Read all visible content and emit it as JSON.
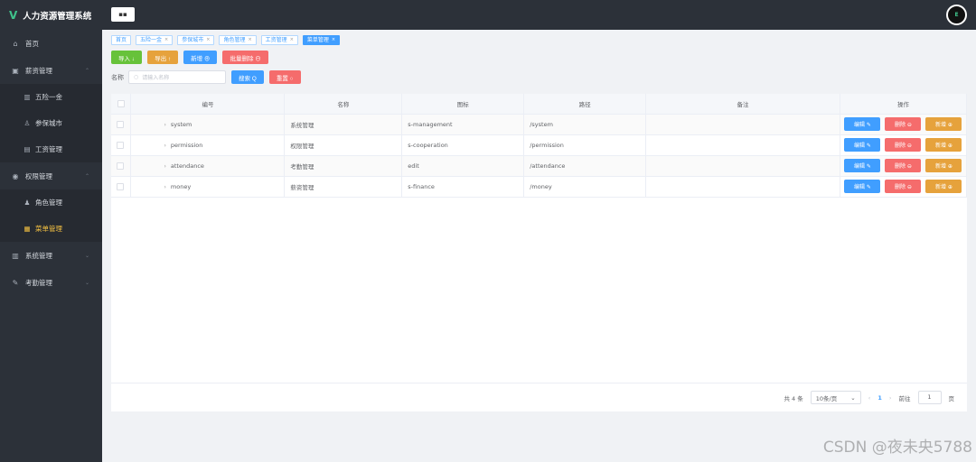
{
  "app": {
    "title": "人力资源管理系统",
    "logo_letter": "V",
    "avatar_text": "E"
  },
  "sidebar": {
    "items": [
      {
        "label": "首页",
        "icon": "home-icon",
        "glyph": "⌂"
      },
      {
        "label": "薪资管理",
        "icon": "salary-icon",
        "glyph": "▣",
        "chev": "⌃"
      },
      {
        "label": "五险一金",
        "icon": "chart-icon",
        "glyph": "▥",
        "sub": true
      },
      {
        "label": "参保城市",
        "icon": "user-icon",
        "glyph": "♙",
        "sub": true
      },
      {
        "label": "工资管理",
        "icon": "document-icon",
        "glyph": "▤",
        "sub": true
      },
      {
        "label": "权限管理",
        "icon": "lock-icon",
        "glyph": "◉",
        "chev": "⌃"
      },
      {
        "label": "角色管理",
        "icon": "person-icon",
        "glyph": "♟",
        "sub": true
      },
      {
        "label": "菜单管理",
        "icon": "menu-icon",
        "glyph": "▦",
        "sub": true,
        "active": true
      },
      {
        "label": "系统管理",
        "icon": "system-icon",
        "glyph": "▥",
        "chev": "⌄"
      },
      {
        "label": "考勤管理",
        "icon": "pen-icon",
        "glyph": "✎",
        "chev": "⌄"
      }
    ]
  },
  "header": {
    "toggle_glyph": "▪▪"
  },
  "tags": [
    {
      "label": "首页",
      "closable": false
    },
    {
      "label": "五险一金",
      "closable": true
    },
    {
      "label": "参保城市",
      "closable": true
    },
    {
      "label": "角色管理",
      "closable": true
    },
    {
      "label": "工资管理",
      "closable": true
    },
    {
      "label": "菜单管理",
      "closable": true,
      "active": true
    }
  ],
  "toolbar": {
    "import": "导入 ↓",
    "export": "导出 ↑",
    "add": "新增 ⊕",
    "batch_delete": "批量删除 ⊖"
  },
  "search": {
    "label": "名称",
    "placeholder": "请输入名称",
    "search_btn": "搜索 Q",
    "reset_btn": "重置 ○"
  },
  "table": {
    "headers": [
      "",
      "编号",
      "名称",
      "图标",
      "路径",
      "备注",
      "操作"
    ],
    "rows": [
      {
        "code": "system",
        "name": "系统管理",
        "icon": "s-management",
        "path": "/system",
        "note": ""
      },
      {
        "code": "permission",
        "name": "权限管理",
        "icon": "s-cooperation",
        "path": "/permission",
        "note": ""
      },
      {
        "code": "attendance",
        "name": "考勤管理",
        "icon": "edit",
        "path": "/attendance",
        "note": ""
      },
      {
        "code": "money",
        "name": "薪资管理",
        "icon": "s-finance",
        "path": "/money",
        "note": ""
      }
    ],
    "actions": {
      "edit": "编辑 ✎",
      "delete": "删除 ⊖",
      "add": "新增 ⊕"
    }
  },
  "pagination": {
    "total": "共 4 条",
    "page_size": "10条/页",
    "prev": "‹",
    "current": "1",
    "next": "›",
    "goto_label": "前往",
    "goto_value": "1",
    "page_suffix": "页"
  },
  "watermark": "CSDN @夜未央5788",
  "colors": {
    "primary": "#409eff",
    "success": "#67c23a",
    "warning": "#e6a23c",
    "danger": "#f56c6c",
    "sidebar": "#2c3139",
    "active_menu": "#f5c242"
  }
}
